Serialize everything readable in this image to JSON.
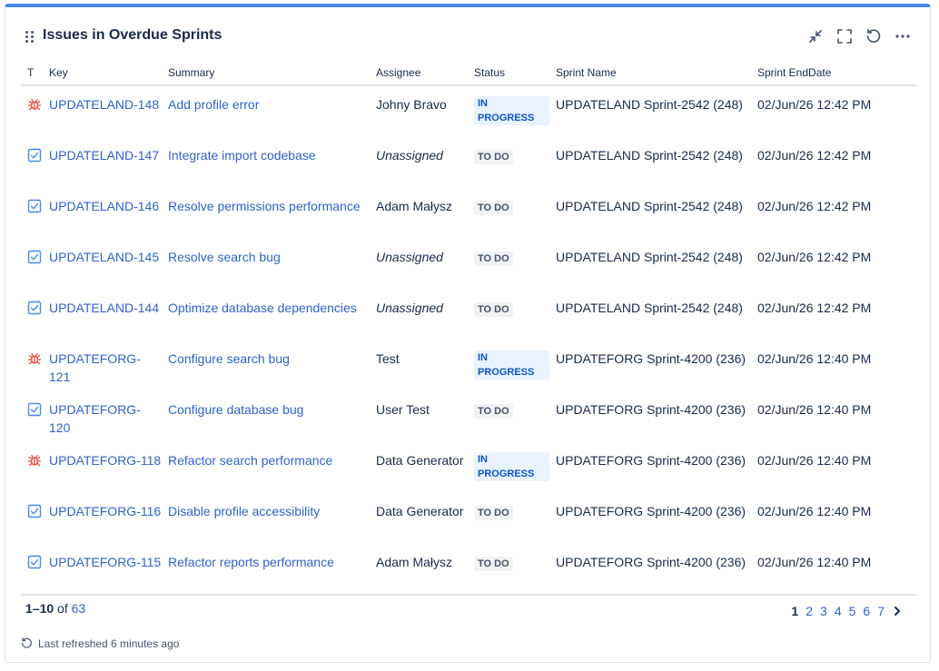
{
  "gadget": {
    "title": "Issues in Overdue Sprints"
  },
  "columns": {
    "t": "T",
    "key": "Key",
    "summary": "Summary",
    "assignee": "Assignee",
    "status": "Status",
    "sprint": "Sprint Name",
    "end": "Sprint EndDate"
  },
  "rows": [
    {
      "type": "bug-icon",
      "key": "UPDATELAND-148",
      "summary": "Add profile error",
      "assignee": "Johny Bravo",
      "unassigned": false,
      "status": "IN PROGRESS",
      "status_kind": "inprogress",
      "sprint": "UPDATELAND Sprint-2542 (248)",
      "end": "02/Jun/26 12:42 PM"
    },
    {
      "type": "task-icon",
      "key": "UPDATELAND-147",
      "summary": "Integrate import codebase",
      "assignee": "Unassigned",
      "unassigned": true,
      "status": "TO DO",
      "status_kind": "todo",
      "sprint": "UPDATELAND Sprint-2542 (248)",
      "end": "02/Jun/26 12:42 PM"
    },
    {
      "type": "task-icon",
      "key": "UPDATELAND-146",
      "summary": "Resolve permissions performance",
      "assignee": "Adam Małysz",
      "unassigned": false,
      "status": "TO DO",
      "status_kind": "todo",
      "sprint": "UPDATELAND Sprint-2542 (248)",
      "end": "02/Jun/26 12:42 PM"
    },
    {
      "type": "task-icon",
      "key": "UPDATELAND-145",
      "summary": "Resolve search bug",
      "assignee": "Unassigned",
      "unassigned": true,
      "status": "TO DO",
      "status_kind": "todo",
      "sprint": "UPDATELAND Sprint-2542 (248)",
      "end": "02/Jun/26 12:42 PM"
    },
    {
      "type": "task-icon",
      "key": "UPDATELAND-144",
      "summary": "Optimize database dependencies",
      "assignee": "Unassigned",
      "unassigned": true,
      "status": "TO DO",
      "status_kind": "todo",
      "sprint": "UPDATELAND Sprint-2542 (248)",
      "end": "02/Jun/26 12:42 PM"
    },
    {
      "type": "bug-icon",
      "key": "UPDATEFORG-121",
      "summary": "Configure search bug",
      "assignee": "Test",
      "unassigned": false,
      "status": "IN PROGRESS",
      "status_kind": "inprogress",
      "sprint": "UPDATEFORG Sprint-4200 (236)",
      "end": "02/Jun/26 12:40 PM"
    },
    {
      "type": "task-icon",
      "key": "UPDATEFORG-120",
      "summary": "Configure database bug",
      "assignee": "User Test",
      "unassigned": false,
      "status": "TO DO",
      "status_kind": "todo",
      "sprint": "UPDATEFORG Sprint-4200 (236)",
      "end": "02/Jun/26 12:40 PM"
    },
    {
      "type": "bug-icon",
      "key": "UPDATEFORG-118",
      "summary": "Refactor search performance",
      "assignee": "Data Generator",
      "unassigned": false,
      "status": "IN PROGRESS",
      "status_kind": "inprogress",
      "sprint": "UPDATEFORG Sprint-4200 (236)",
      "end": "02/Jun/26 12:40 PM"
    },
    {
      "type": "task-icon",
      "key": "UPDATEFORG-116",
      "summary": "Disable profile accessibility",
      "assignee": "Data Generator",
      "unassigned": false,
      "status": "TO DO",
      "status_kind": "todo",
      "sprint": "UPDATEFORG Sprint-4200 (236)",
      "end": "02/Jun/26 12:40 PM"
    },
    {
      "type": "task-icon",
      "key": "UPDATEFORG-115",
      "summary": "Refactor reports performance",
      "assignee": "Adam Małysz",
      "unassigned": false,
      "status": "TO DO",
      "status_kind": "todo",
      "sprint": "UPDATEFORG Sprint-4200 (236)",
      "end": "02/Jun/26 12:40 PM"
    }
  ],
  "footer": {
    "range": "1–10",
    "of": "of",
    "total": "63",
    "pages": [
      "1",
      "2",
      "3",
      "4",
      "5",
      "6",
      "7"
    ],
    "current_page": "1",
    "refreshed": "Last refreshed 6 minutes ago"
  },
  "colors": {
    "accent": "#4688ec",
    "link": "#2e64c9",
    "bug": "#e2483d",
    "task": "#4688ec"
  }
}
